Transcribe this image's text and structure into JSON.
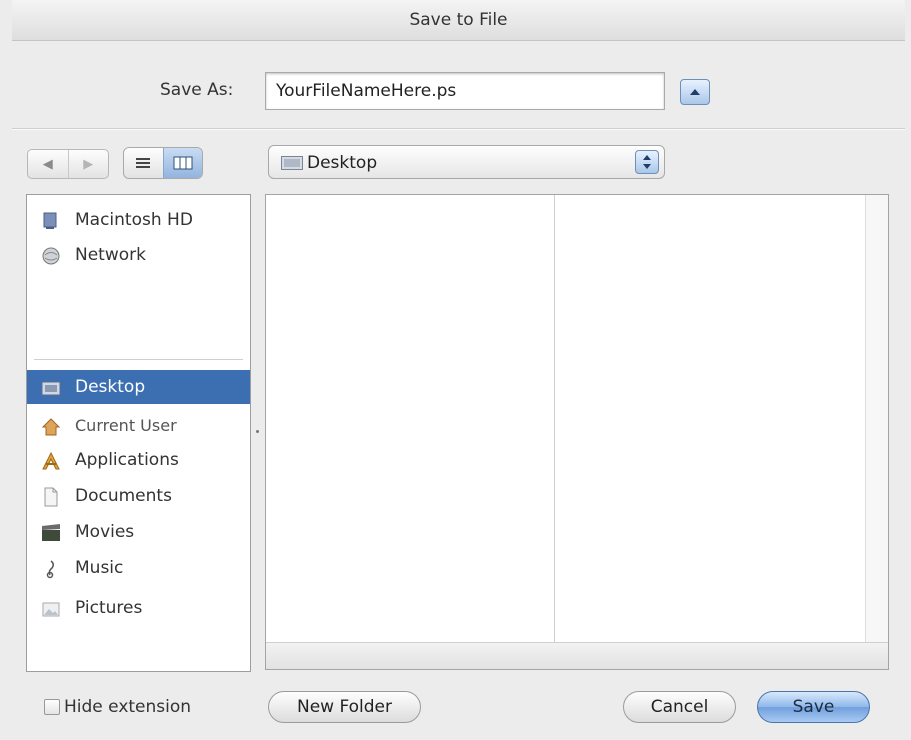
{
  "dialog": {
    "title": "Save to File"
  },
  "save_as": {
    "label": "Save As:",
    "value": "YourFileNameHere.ps"
  },
  "location": {
    "label": "Desktop"
  },
  "sidebar": {
    "devices": [
      {
        "label": "Macintosh HD",
        "icon": "hard-drive-icon"
      },
      {
        "label": "Network",
        "icon": "network-globe-icon"
      }
    ],
    "places": [
      {
        "label": "Desktop",
        "icon": "desktop-folder-icon",
        "selected": true
      },
      {
        "label": "Current User",
        "icon": "home-icon"
      },
      {
        "label": "Applications",
        "icon": "applications-icon"
      },
      {
        "label": "Documents",
        "icon": "documents-icon"
      },
      {
        "label": "Movies",
        "icon": "movies-icon"
      },
      {
        "label": "Music",
        "icon": "music-icon"
      },
      {
        "label": "Pictures",
        "icon": "pictures-icon"
      }
    ]
  },
  "footer": {
    "hide_extension": {
      "label": "Hide extension",
      "checked": false
    },
    "new_folder": "New Folder",
    "cancel": "Cancel",
    "save": "Save"
  },
  "colors": {
    "selection": "#3c6fb2",
    "aqua_blue": "#6f9fdd"
  }
}
